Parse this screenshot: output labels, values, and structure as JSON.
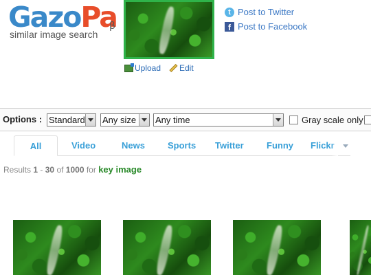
{
  "logo": {
    "word_parts": [
      "Ga",
      "zo",
      "Pa"
    ],
    "beta": "β",
    "tagline": "similar image search"
  },
  "tools": {
    "upload_label": "Upload",
    "edit_label": "Edit"
  },
  "social": {
    "twitter_label": "Post to Twitter",
    "facebook_label": "Post to Facebook"
  },
  "options": {
    "label": "Options :",
    "mode": "Standard",
    "size": "Any size",
    "time": "Any time",
    "grayscale_label": "Gray scale only"
  },
  "tabs": [
    "All",
    "Video",
    "News",
    "Sports",
    "Twitter",
    "Funny",
    "Flickr"
  ],
  "active_tab": "All",
  "results": {
    "prefix": "Results",
    "from": "1",
    "dash": "-",
    "to": "30",
    "of": "of",
    "total": "1000",
    "for": "for",
    "query": "key image"
  },
  "colors": {
    "accent": "#3aa0d8",
    "query_green": "#2a8a2a",
    "thumb_border": "#2fb34a",
    "logo_blue": "#3a89c9",
    "logo_red": "#e84d2a"
  }
}
